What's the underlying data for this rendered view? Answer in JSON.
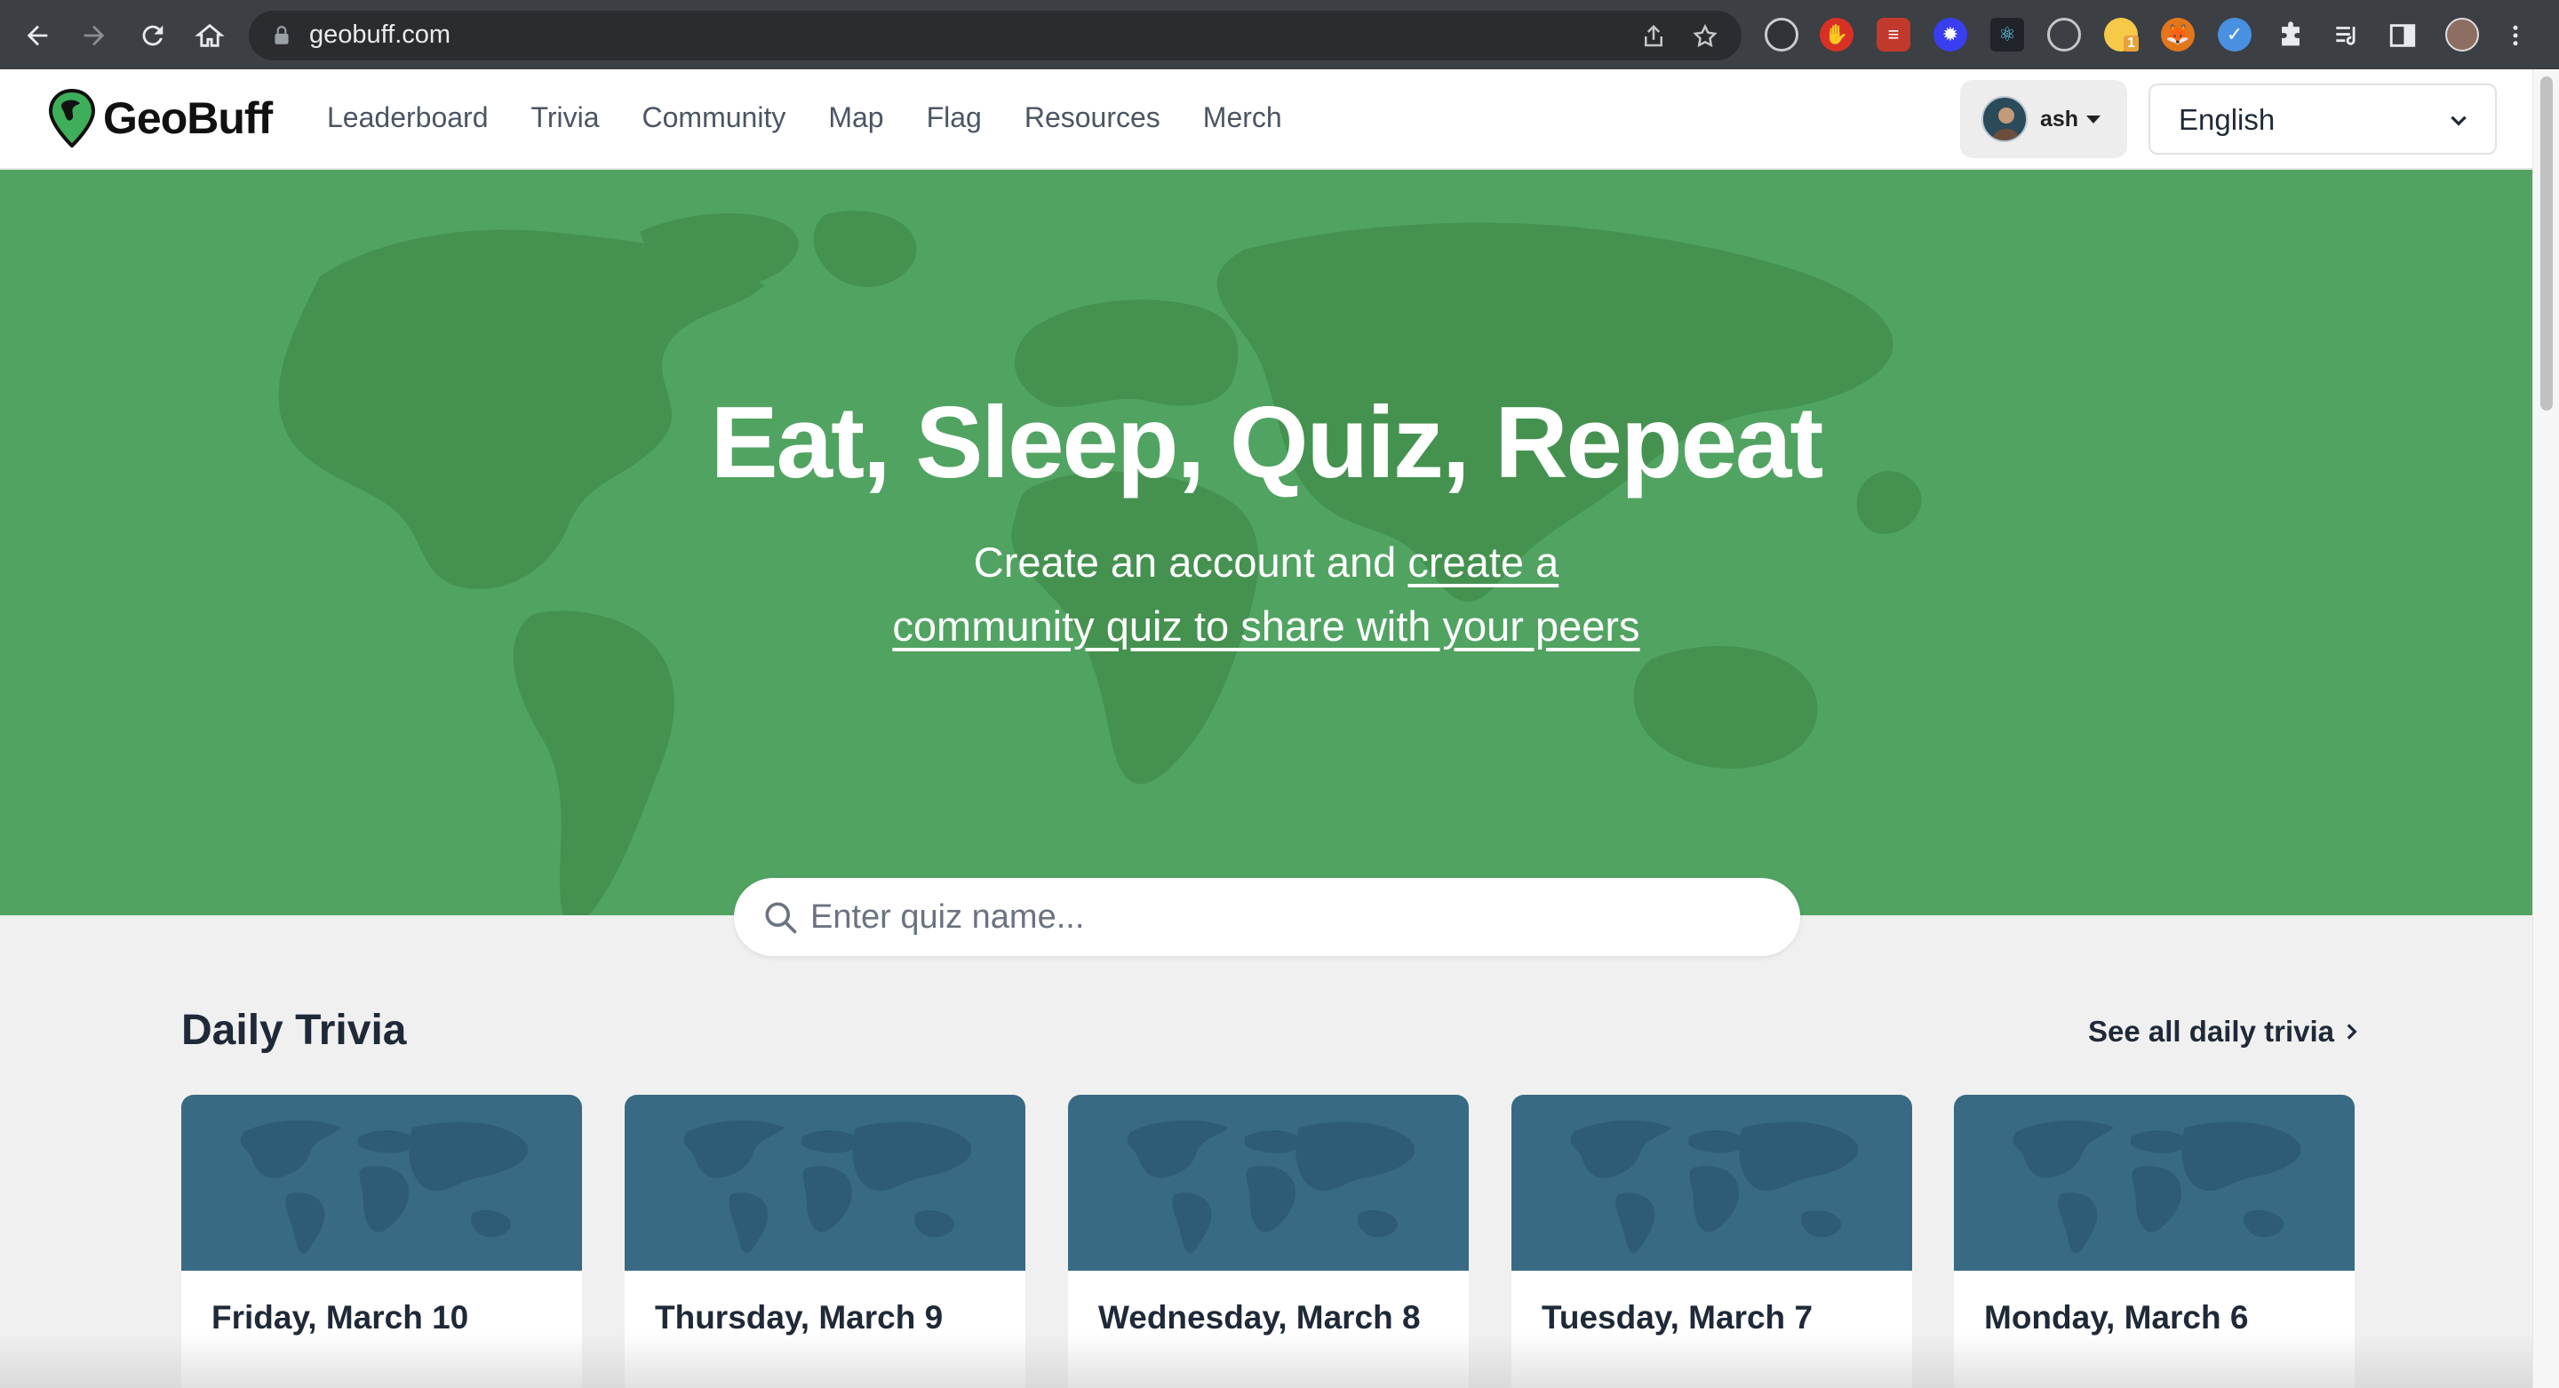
{
  "browser": {
    "url": "geobuff.com",
    "extension_badge": "1",
    "icons": [
      "back-icon",
      "forward-icon",
      "reload-icon",
      "home-icon",
      "lock-icon",
      "share-icon",
      "bookmark-star-icon",
      "extensions-puzzle-icon",
      "reading-list-icon",
      "side-panel-icon",
      "profile-avatar",
      "more-menu-icon"
    ]
  },
  "header": {
    "logo_text": "GeoBuff",
    "nav": [
      "Leaderboard",
      "Trivia",
      "Community",
      "Map",
      "Flag",
      "Resources",
      "Merch"
    ],
    "user_name": "ash",
    "language": "English"
  },
  "hero": {
    "title": "Eat, Sleep, Quiz, Repeat",
    "subtitle_plain": "Create an account and ",
    "subtitle_link": "create a community quiz to share with your peers",
    "bg_color": "#51a362"
  },
  "search": {
    "placeholder": "Enter quiz name..."
  },
  "daily_trivia": {
    "title": "Daily Trivia",
    "see_all": "See all daily trivia",
    "cards": [
      {
        "title": "Friday, March 10"
      },
      {
        "title": "Thursday, March 9"
      },
      {
        "title": "Wednesday, March 8"
      },
      {
        "title": "Tuesday, March 7"
      },
      {
        "title": "Monday, March 6"
      }
    ],
    "card_color": "#386a84"
  }
}
